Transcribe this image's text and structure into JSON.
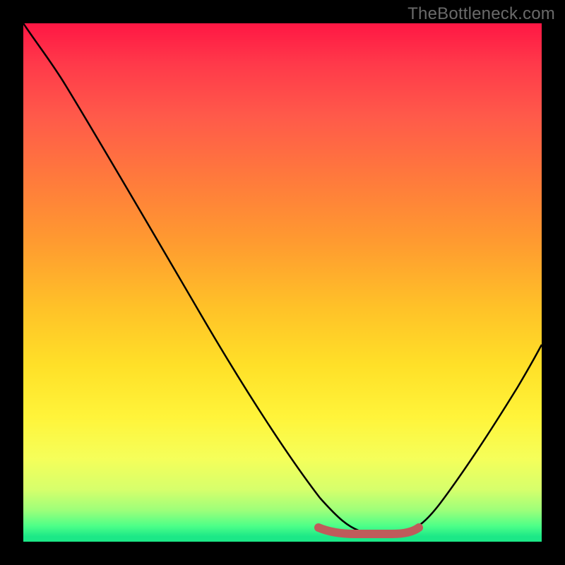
{
  "watermark": "TheBottleneck.com",
  "chart_data": {
    "type": "line",
    "title": "",
    "xlabel": "",
    "ylabel": "",
    "xlim": [
      0,
      100
    ],
    "ylim": [
      0,
      100
    ],
    "legend": false,
    "grid": false,
    "series": [
      {
        "name": "bottleneck-curve",
        "color": "#000000",
        "x": [
          0,
          5,
          10,
          15,
          20,
          25,
          30,
          35,
          40,
          45,
          50,
          55,
          58,
          60,
          63,
          66,
          69,
          72,
          74,
          78,
          82,
          86,
          90,
          94,
          98,
          100
        ],
        "y": [
          100,
          94,
          88,
          82,
          75,
          68,
          60,
          52,
          44,
          35,
          26,
          16,
          10,
          6,
          3,
          2,
          2,
          2,
          3,
          6,
          11,
          17,
          24,
          31,
          38,
          42
        ]
      },
      {
        "name": "optimal-band",
        "color": "#bf5b5b",
        "x": [
          57,
          58,
          60,
          63,
          66,
          69,
          72,
          74,
          75
        ],
        "y": [
          3,
          2,
          2,
          2,
          2,
          2,
          2,
          2,
          3
        ]
      }
    ],
    "background_gradient": {
      "top": "#ff1744",
      "mid": "#ffe028",
      "bottom": "#1ce887"
    }
  }
}
